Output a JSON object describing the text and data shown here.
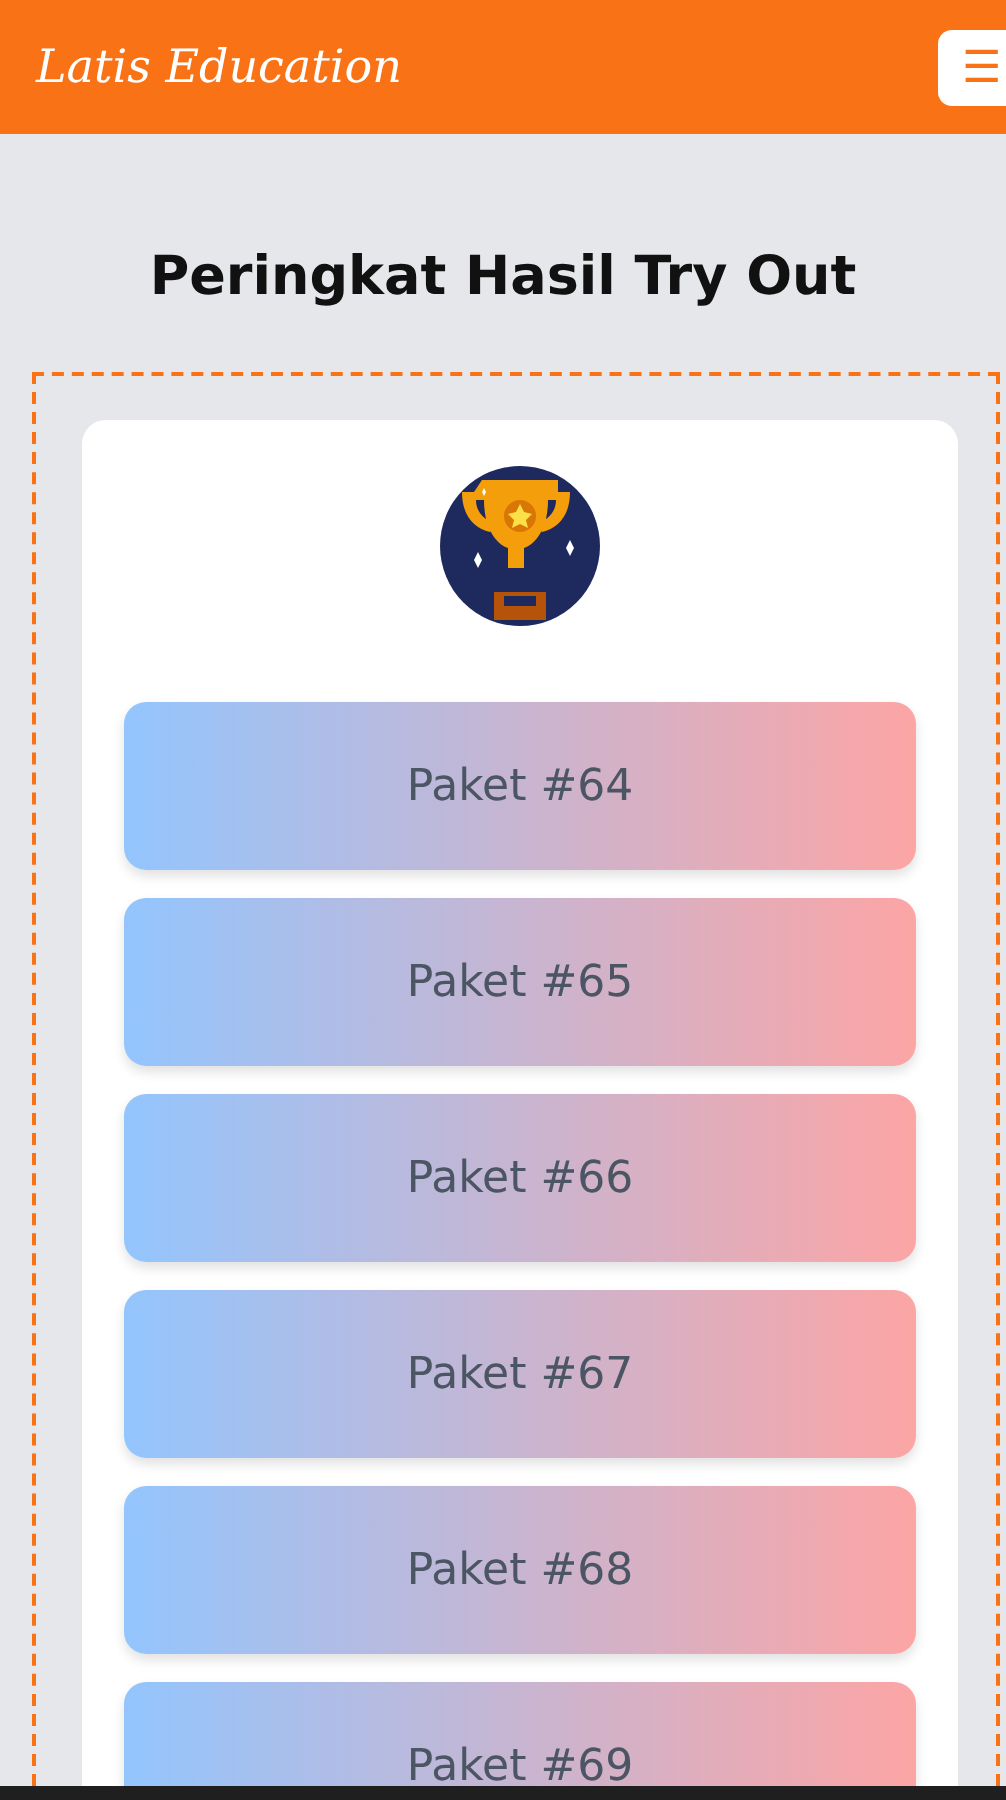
{
  "header": {
    "brand": "Latis Education",
    "menu_icon": "☰"
  },
  "title": "Peringkat Hasil Try Out",
  "packages": [
    {
      "label": "Paket #64"
    },
    {
      "label": "Paket #65"
    },
    {
      "label": "Paket #66"
    },
    {
      "label": "Paket #67"
    },
    {
      "label": "Paket #68"
    },
    {
      "label": "Paket #69"
    }
  ]
}
